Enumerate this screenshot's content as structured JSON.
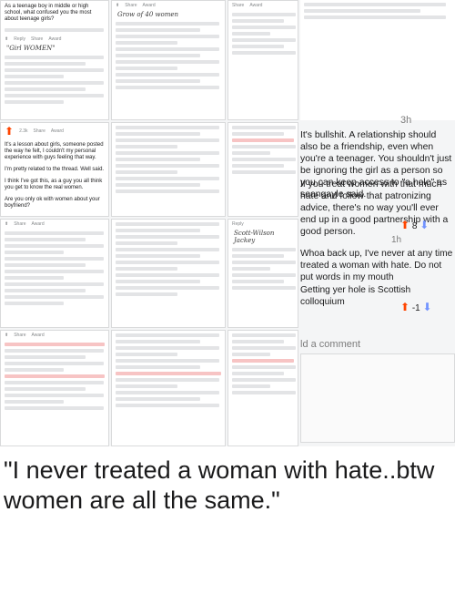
{
  "collage": {
    "top_left": {
      "title": "As a teenage boy in middle or high school, what confused you the most about teenage girls?",
      "handwritten": "Grow of 40 women",
      "quote": "\"Girl WOMEN\""
    },
    "middle_left": {
      "score": "2.3k",
      "body1": "It's a lesson about girls, someone posted the way he felt, I couldn't my personal experience with guys feeling that way.",
      "body2": "I'm pretty related to the thread. Well said.",
      "body3": "I think I've got this, as a guy you all think you get to know the real women.",
      "body4": "Are you only ok with women about your boyfriend?"
    },
    "right_top": {
      "age": "3h",
      "text": "It's bullshit. A relationship should also be a friendship, even when you're a teenager. You shouldn't just be ignoring the girl as a person so you can keep access to \"a hole\" as seangayle said."
    },
    "right_mid": {
      "text": "If you treat women with that much hate and follow that patronizing advice, there's no way you'll ever end up in a good partnership with a good person.",
      "score": "8"
    },
    "right_lower": {
      "age": "1h",
      "handwritten": "Scott-Wilson Jackey",
      "text1": "Whoa back up, I've never at any time treated a woman with hate. Do not put words in my mouth",
      "text2": "Getting yer hole is Scottish colloquium",
      "score": "-1"
    },
    "bottom_right": {
      "prompt": "ld a comment"
    },
    "bar": {
      "reply": "Reply",
      "share": "Share",
      "award": "Award"
    }
  },
  "caption": {
    "text": "\"I never treated a woman with hate..btw women are all the same.\""
  }
}
